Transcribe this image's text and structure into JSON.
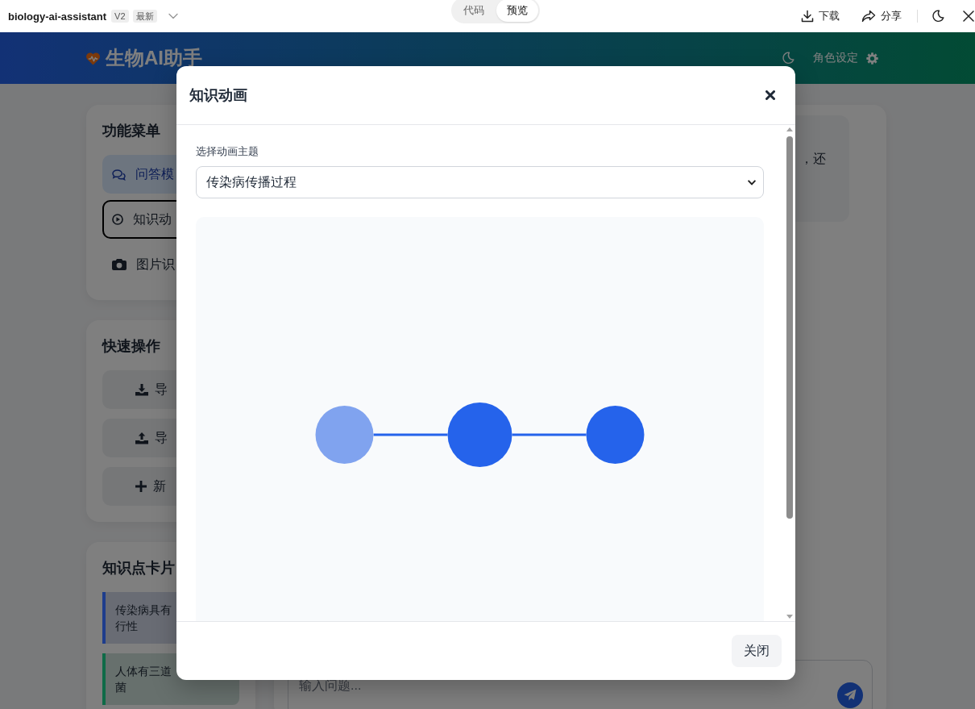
{
  "toolbar": {
    "project": "biology-ai-assistant",
    "version": "V2",
    "tag": "最新",
    "view_tabs": [
      {
        "label": "代码",
        "selected": false
      },
      {
        "label": "预览",
        "selected": true
      }
    ],
    "actions": [
      {
        "kind": "download",
        "label": "下载"
      },
      {
        "kind": "share",
        "label": "分享"
      },
      {
        "kind": "theme"
      },
      {
        "kind": "close"
      }
    ]
  },
  "app_header": {
    "title": "生物AI助手",
    "role_label": "角色设定"
  },
  "sidebar": {
    "menu": {
      "title": "功能菜单",
      "items": [
        {
          "kind": "chat",
          "label": "问答模",
          "selected": true,
          "focused": false
        },
        {
          "kind": "play",
          "label": "知识动",
          "selected": false,
          "focused": true
        },
        {
          "kind": "camera",
          "label": "图片识",
          "selected": false,
          "focused": false
        }
      ]
    },
    "quick_actions": {
      "title": "快速操作",
      "items": [
        {
          "kind": "download",
          "label": "导"
        },
        {
          "kind": "upload",
          "label": "导"
        },
        {
          "kind": "plus",
          "label": "新"
        }
      ]
    },
    "knowledge_cards": {
      "title": "知识点卡片",
      "items": [
        {
          "lines": [
            "传染病具有",
            "行性"
          ],
          "color": "#1e3d8c"
        },
        {
          "lines": [
            "人体有三道",
            "菌"
          ],
          "color": "#0f6b47"
        }
      ]
    }
  },
  "chat": {
    "message": "，还",
    "input": {
      "placeholder": "输入问题..."
    }
  },
  "modal": {
    "title": "知识动画",
    "field_label": "选择动画主题",
    "topic": "传染病传播过程",
    "animation": {
      "nodes": [
        {
          "kind": "faded"
        },
        {
          "kind": "enlarged"
        },
        {
          "kind": "solid"
        }
      ]
    },
    "close_label": "关闭"
  }
}
